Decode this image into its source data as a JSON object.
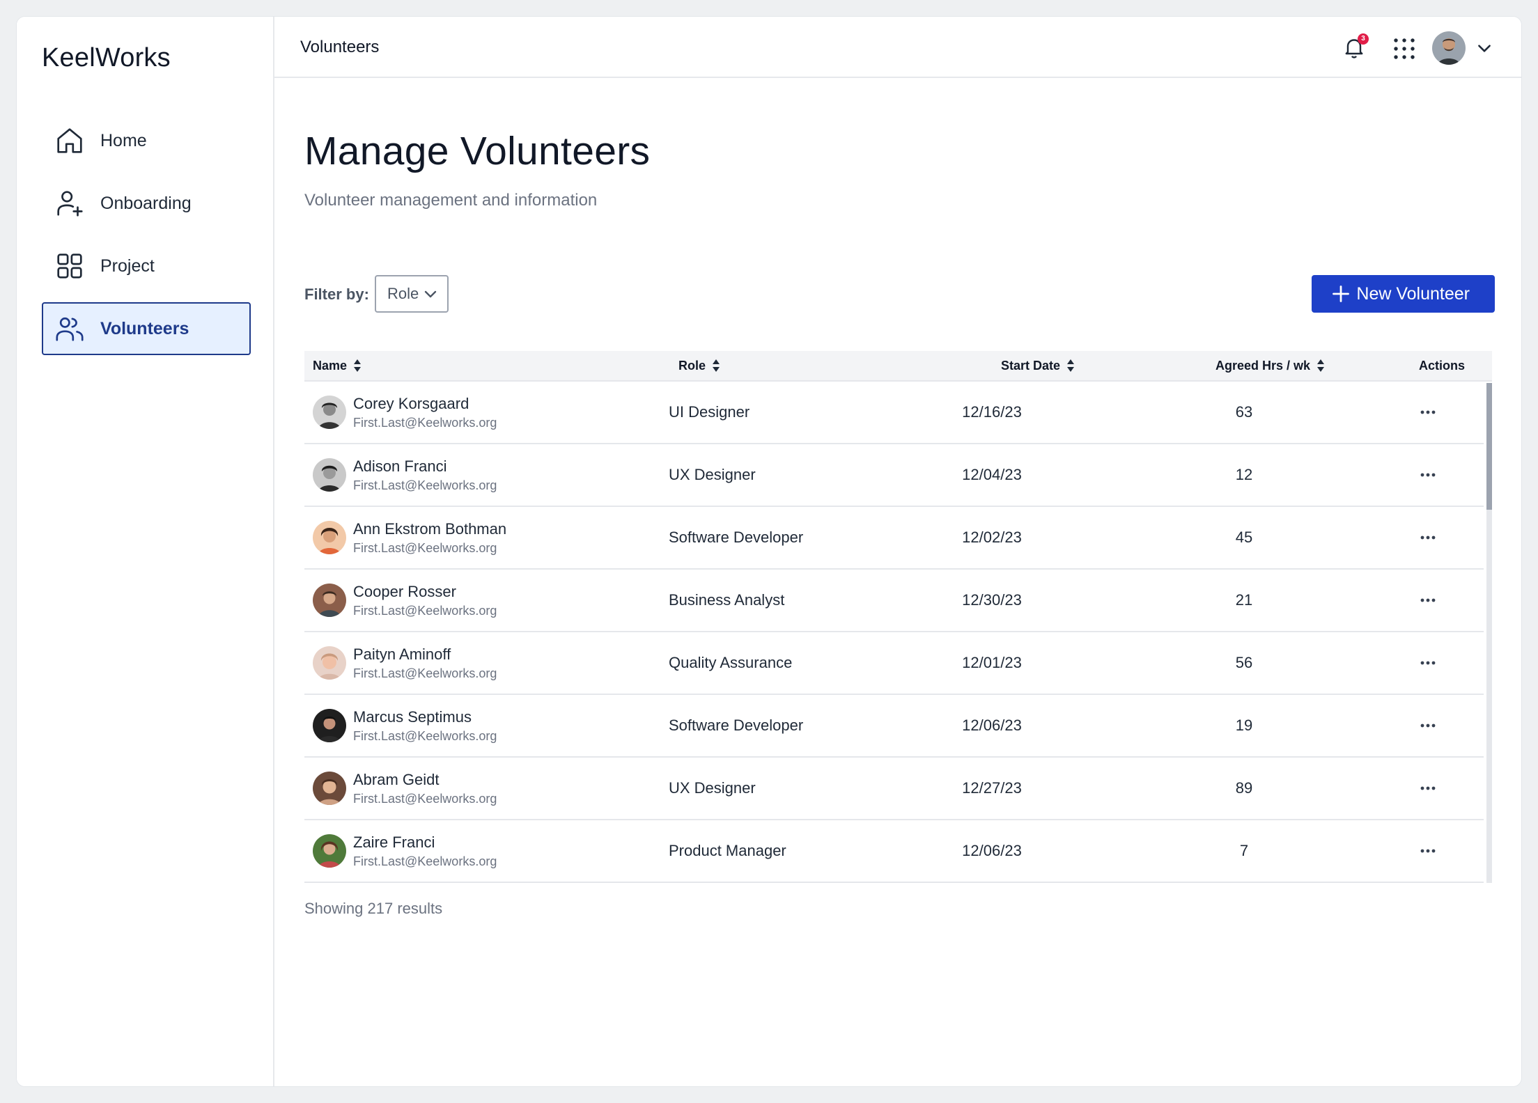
{
  "app": {
    "brand": "KeelWorks"
  },
  "sidebar": {
    "items": [
      {
        "label": "Home",
        "icon": "home-icon",
        "active": false
      },
      {
        "label": "Onboarding",
        "icon": "user-plus-icon",
        "active": false
      },
      {
        "label": "Project",
        "icon": "grid-icon",
        "active": false
      },
      {
        "label": "Volunteers",
        "icon": "users-icon",
        "active": true
      }
    ]
  },
  "header": {
    "breadcrumb": "Volunteers",
    "notification_count": "3"
  },
  "main": {
    "title": "Manage Volunteers",
    "subtitle": "Volunteer management and information",
    "filter_label": "Filter by:",
    "filter_value": "Role",
    "new_button": "New Volunteer",
    "results_text": "Showing 217 results"
  },
  "table": {
    "columns": [
      "Name",
      "Role",
      "Start Date",
      "Agreed Hrs / wk",
      "Actions"
    ],
    "rows": [
      {
        "name": "Corey Korsgaard",
        "email": "First.Last@Keelworks.org",
        "role": "UI Designer",
        "start_date": "12/16/23",
        "hours": "63"
      },
      {
        "name": "Adison Franci",
        "email": "First.Last@Keelworks.org",
        "role": "UX Designer",
        "start_date": "12/04/23",
        "hours": "12"
      },
      {
        "name": "Ann Ekstrom Bothman",
        "email": "First.Last@Keelworks.org",
        "role": "Software Developer",
        "start_date": "12/02/23",
        "hours": "45"
      },
      {
        "name": "Cooper Rosser",
        "email": "First.Last@Keelworks.org",
        "role": "Business Analyst",
        "start_date": "12/30/23",
        "hours": "21"
      },
      {
        "name": "Paityn Aminoff",
        "email": "First.Last@Keelworks.org",
        "role": "Quality Assurance",
        "start_date": "12/01/23",
        "hours": "56"
      },
      {
        "name": "Marcus Septimus",
        "email": "First.Last@Keelworks.org",
        "role": "Software Developer",
        "start_date": "12/06/23",
        "hours": "19"
      },
      {
        "name": "Abram Geidt",
        "email": "First.Last@Keelworks.org",
        "role": "UX Designer",
        "start_date": "12/27/23",
        "hours": "89"
      },
      {
        "name": "Zaire Franci",
        "email": "First.Last@Keelworks.org",
        "role": "Product Manager",
        "start_date": "12/06/23",
        "hours": "7"
      }
    ]
  },
  "colors": {
    "accent": "#1e40c8",
    "active_bg": "#e6f0ff",
    "active_border": "#1e3a8a",
    "badge": "#e11d48"
  }
}
